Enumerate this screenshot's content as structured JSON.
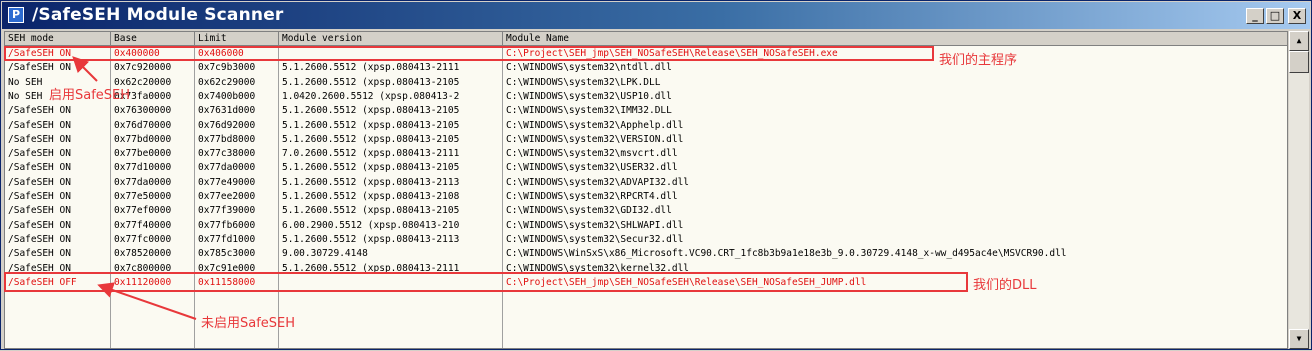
{
  "window": {
    "title": "/SafeSEH Module Scanner",
    "icon_letter": "P",
    "buttons": [
      "_",
      "□",
      "X"
    ]
  },
  "table": {
    "columns": [
      "SEH mode",
      "Base",
      "Limit",
      "Module version",
      "Module Name"
    ],
    "rows": [
      [
        "/SafeSEH ON",
        "0x400000",
        "0x406000",
        "",
        "C:\\Project\\SEH_jmp\\SEH_NOSafeSEH\\Release\\SEH_NOSafeSEH.exe"
      ],
      [
        "/SafeSEH ON",
        "0x7c920000",
        "0x7c9b3000",
        "5.1.2600.5512 (xpsp.080413-2111",
        "C:\\WINDOWS\\system32\\ntdll.dll"
      ],
      [
        "No SEH",
        "0x62c20000",
        "0x62c29000",
        "5.1.2600.5512 (xpsp.080413-2105",
        "C:\\WINDOWS\\system32\\LPK.DLL"
      ],
      [
        "No SEH",
        "0x73fa0000",
        "0x7400b000",
        "1.0420.2600.5512 (xpsp.080413-2",
        "C:\\WINDOWS\\system32\\USP10.dll"
      ],
      [
        "/SafeSEH ON",
        "0x76300000",
        "0x7631d000",
        "5.1.2600.5512 (xpsp.080413-2105",
        "C:\\WINDOWS\\system32\\IMM32.DLL"
      ],
      [
        "/SafeSEH ON",
        "0x76d70000",
        "0x76d92000",
        "5.1.2600.5512 (xpsp.080413-2105",
        "C:\\WINDOWS\\system32\\Apphelp.dll"
      ],
      [
        "/SafeSEH ON",
        "0x77bd0000",
        "0x77bd8000",
        "5.1.2600.5512 (xpsp.080413-2105",
        "C:\\WINDOWS\\system32\\VERSION.dll"
      ],
      [
        "/SafeSEH ON",
        "0x77be0000",
        "0x77c38000",
        "7.0.2600.5512 (xpsp.080413-2111",
        "C:\\WINDOWS\\system32\\msvcrt.dll"
      ],
      [
        "/SafeSEH ON",
        "0x77d10000",
        "0x77da0000",
        "5.1.2600.5512 (xpsp.080413-2105",
        "C:\\WINDOWS\\system32\\USER32.dll"
      ],
      [
        "/SafeSEH ON",
        "0x77da0000",
        "0x77e49000",
        "5.1.2600.5512 (xpsp.080413-2113",
        "C:\\WINDOWS\\system32\\ADVAPI32.dll"
      ],
      [
        "/SafeSEH ON",
        "0x77e50000",
        "0x77ee2000",
        "5.1.2600.5512 (xpsp.080413-2108",
        "C:\\WINDOWS\\system32\\RPCRT4.dll"
      ],
      [
        "/SafeSEH ON",
        "0x77ef0000",
        "0x77f39000",
        "5.1.2600.5512 (xpsp.080413-2105",
        "C:\\WINDOWS\\system32\\GDI32.dll"
      ],
      [
        "/SafeSEH ON",
        "0x77f40000",
        "0x77fb6000",
        "6.00.2900.5512 (xpsp.080413-210",
        "C:\\WINDOWS\\system32\\SHLWAPI.dll"
      ],
      [
        "/SafeSEH ON",
        "0x77fc0000",
        "0x77fd1000",
        "5.1.2600.5512 (xpsp.080413-2113",
        "C:\\WINDOWS\\system32\\Secur32.dll"
      ],
      [
        "/SafeSEH ON",
        "0x78520000",
        "0x785c3000",
        "9.00.30729.4148",
        "C:\\WINDOWS\\WinSxS\\x86_Microsoft.VC90.CRT_1fc8b3b9a1e18e3b_9.0.30729.4148_x-ww_d495ac4e\\MSVCR90.dll"
      ],
      [
        "/SafeSEH ON",
        "0x7c800000",
        "0x7c91e000",
        "5.1.2600.5512 (xpsp.080413-2111",
        "C:\\WINDOWS\\system32\\kernel32.dll"
      ],
      [
        "/SafeSEH OFF",
        "0x11120000",
        "0x11158000",
        "",
        "C:\\Project\\SEH_jmp\\SEH_NOSafeSEH\\Release\\SEH_NOSafeSEH_JUMP.dll"
      ]
    ]
  },
  "annotations": {
    "main_program": "我们的主程序",
    "enabled_safeseh": "启用SafeSEH",
    "our_dll": "我们的DLL",
    "not_enabled_safeseh": "未启用SafeSEH"
  },
  "colors": {
    "annotation": "#e8383b",
    "highlight_text": "#e01010"
  }
}
